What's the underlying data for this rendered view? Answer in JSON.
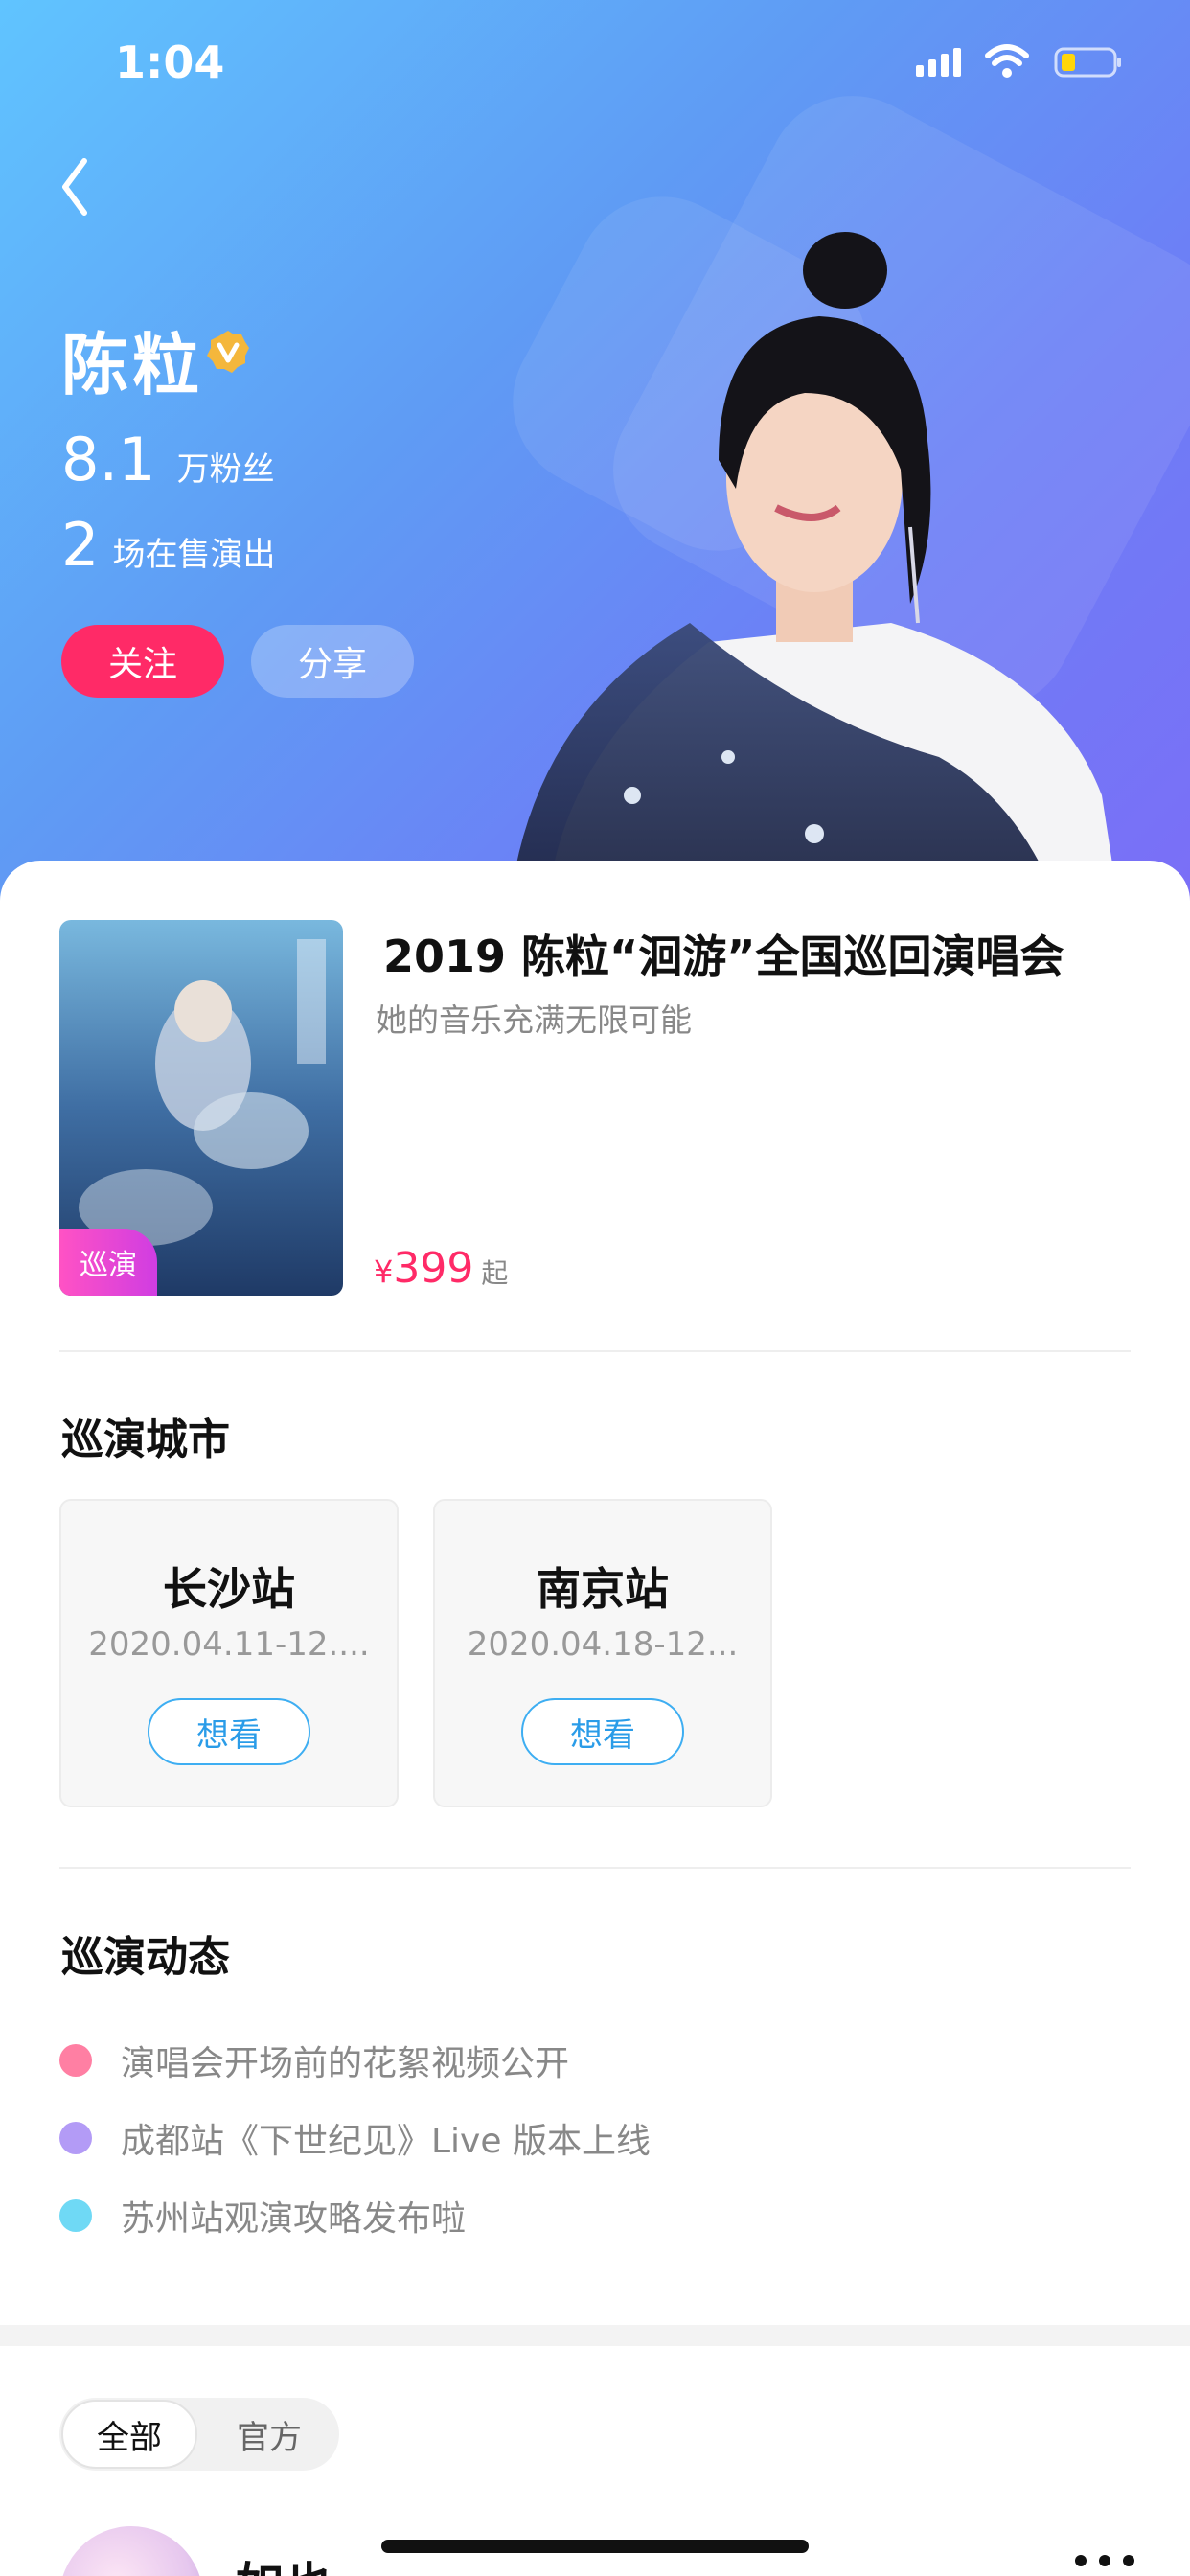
{
  "status_bar": {
    "time": "1:04"
  },
  "artist": {
    "name": "陈粒",
    "fans_value": "8.1",
    "fans_label": "万粉丝",
    "shows_value": "2",
    "shows_label": "场在售演出",
    "follow_label": "关注",
    "share_label": "分享"
  },
  "show": {
    "title": "2019 陈粒“洄游”全国巡回演唱会",
    "subtitle": "她的音乐充满无限可能",
    "tag": "巡演",
    "price_currency": "¥",
    "price_amount": "399",
    "price_suffix": "起"
  },
  "tour_cities": {
    "title": "巡演城市",
    "cities": [
      {
        "name": "长沙站",
        "date": "2020.04.11-12....",
        "button": "想看"
      },
      {
        "name": "南京站",
        "date": "2020.04.18-12...",
        "button": "想看"
      }
    ]
  },
  "tour_news": {
    "title": "巡演动态",
    "items": [
      {
        "text": "演唱会开场前的花絮视频公开",
        "color": "#ff7fa3"
      },
      {
        "text": "成都站《下世纪见》Live 版本上线",
        "color": "#b39bf6"
      },
      {
        "text": "苏州站观演攻略发布啦",
        "color": "#6fd9f5"
      }
    ]
  },
  "feed": {
    "tabs": [
      "全部",
      "官方"
    ],
    "first_post_user": "如也"
  },
  "colors": {
    "accent": "#ff2a67",
    "blue": "#3eaef2"
  }
}
